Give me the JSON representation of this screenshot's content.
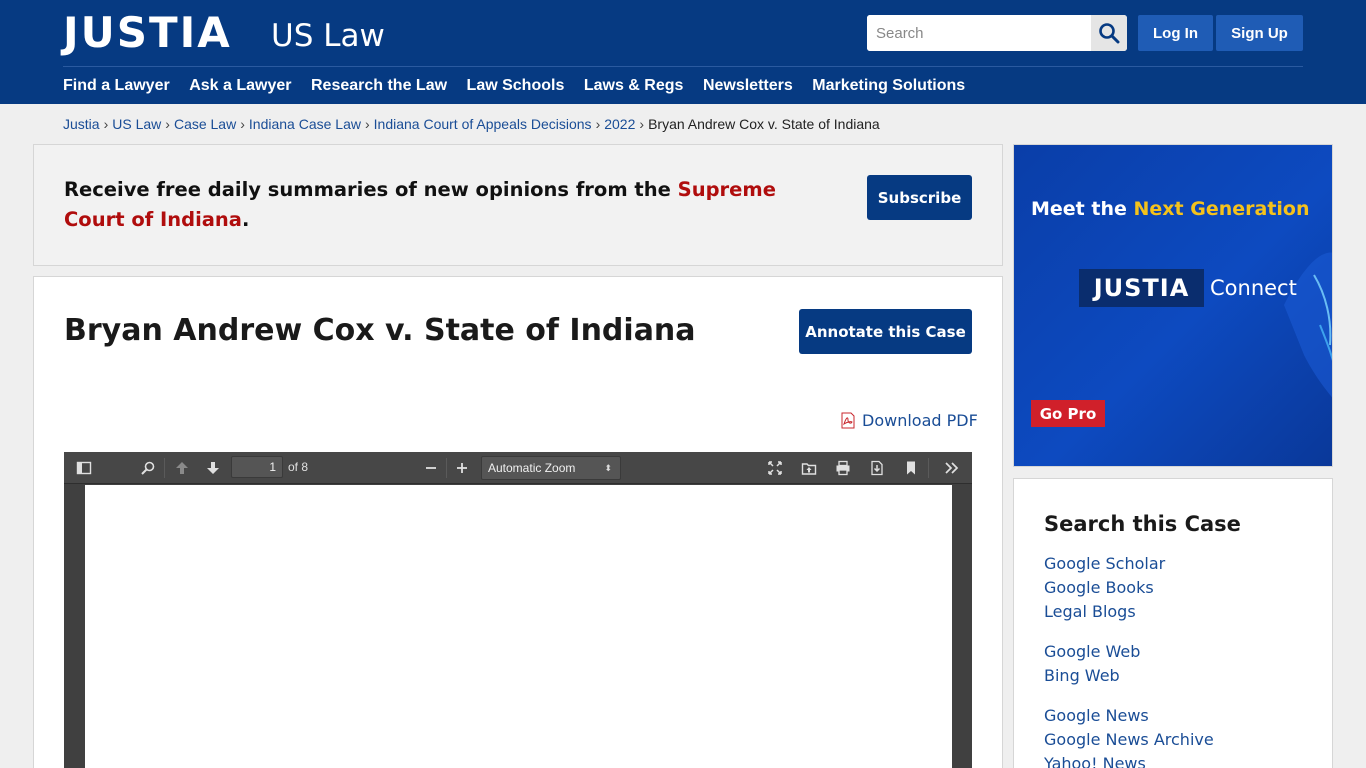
{
  "header": {
    "logo": "JUSTIA",
    "logo_sub": "US Law",
    "search_placeholder": "Search",
    "login_label": "Log In",
    "signup_label": "Sign Up",
    "nav": [
      "Find a Lawyer",
      "Ask a Lawyer",
      "Research the Law",
      "Law Schools",
      "Laws & Regs",
      "Newsletters",
      "Marketing Solutions"
    ]
  },
  "breadcrumb": {
    "items": [
      "Justia",
      "US Law",
      "Case Law",
      "Indiana Case Law",
      "Indiana Court of Appeals Decisions",
      "2022"
    ],
    "current": "Bryan Andrew Cox v. State of Indiana",
    "separator": "›"
  },
  "subscribe": {
    "text_before": "Receive free daily summaries of new opinions from the ",
    "court": "Supreme Court of Indiana",
    "text_after": ".",
    "button_label": "Subscribe"
  },
  "case": {
    "title": "Bryan Andrew Cox v. State of Indiana",
    "annotate_label": "Annotate this Case",
    "download_label": "Download PDF"
  },
  "pdf_viewer": {
    "page_number": "1",
    "page_count": "of 8",
    "zoom": "Automatic Zoom"
  },
  "ad": {
    "headline_before": "Meet the ",
    "headline_highlight": "Next Generation",
    "logo": "JUSTIA",
    "logo_connect": "Connect",
    "cta": "Go Pro"
  },
  "search_case": {
    "title": "Search this Case",
    "links": [
      "Google Scholar",
      "Google Books",
      "Legal Blogs",
      "Google Web",
      "Bing Web",
      "Google News",
      "Google News Archive",
      "Yahoo! News"
    ]
  },
  "colors": {
    "header_bg": "#063a82",
    "button_blue": "#1f5cb5",
    "link": "#1a4d96",
    "court_red": "#b00d0d",
    "ad_yellow": "#f5c21b",
    "ad_red": "#d0202a"
  }
}
